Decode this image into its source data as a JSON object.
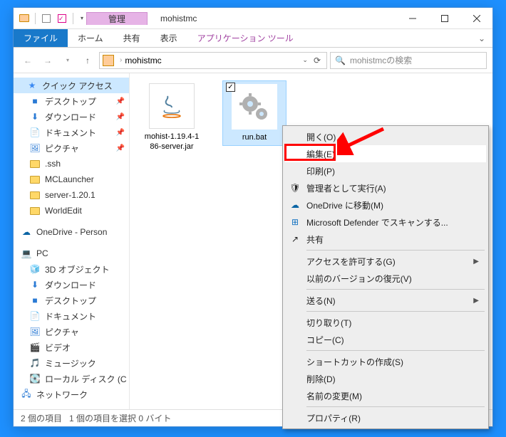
{
  "window": {
    "title": "mohistmc",
    "management_tab": "管理",
    "app_tools_tab": "アプリケーション ツール"
  },
  "ribbon": {
    "file": "ファイル",
    "home": "ホーム",
    "share": "共有",
    "view": "表示"
  },
  "address": {
    "folder": "mohistmc"
  },
  "search": {
    "placeholder": "mohistmcの検索"
  },
  "sidebar": {
    "quick_access": "クイック アクセス",
    "items_qa": [
      {
        "label": "デスクトップ",
        "pinned": true,
        "icon": "desktop"
      },
      {
        "label": "ダウンロード",
        "pinned": true,
        "icon": "download"
      },
      {
        "label": "ドキュメント",
        "pinned": true,
        "icon": "document"
      },
      {
        "label": "ピクチャ",
        "pinned": true,
        "icon": "picture"
      },
      {
        "label": ".ssh",
        "pinned": false,
        "icon": "folder"
      },
      {
        "label": "MCLauncher",
        "pinned": false,
        "icon": "folder"
      },
      {
        "label": "server-1.20.1",
        "pinned": false,
        "icon": "folder"
      },
      {
        "label": "WorldEdit",
        "pinned": false,
        "icon": "folder"
      }
    ],
    "onedrive": "OneDrive - Person",
    "pc": "PC",
    "items_pc": [
      {
        "label": "3D オブジェクト",
        "icon": "3d"
      },
      {
        "label": "ダウンロード",
        "icon": "download"
      },
      {
        "label": "デスクトップ",
        "icon": "desktop"
      },
      {
        "label": "ドキュメント",
        "icon": "document"
      },
      {
        "label": "ピクチャ",
        "icon": "picture"
      },
      {
        "label": "ビデオ",
        "icon": "video"
      },
      {
        "label": "ミュージック",
        "icon": "music"
      },
      {
        "label": "ローカル ディスク (C",
        "icon": "disk"
      }
    ],
    "network": "ネットワーク"
  },
  "files": [
    {
      "name": "mohist-1.19.4-186-server.jar",
      "type": "jar"
    },
    {
      "name": "run.bat",
      "type": "bat",
      "selected": true
    }
  ],
  "context_menu": {
    "open": "開く(O)",
    "edit": "編集(E)",
    "print": "印刷(P)",
    "run_admin": "管理者として実行(A)",
    "onedrive_move": "OneDrive に移動(M)",
    "defender": "Microsoft Defender でスキャンする...",
    "share": "共有",
    "access": "アクセスを許可する(G)",
    "restore": "以前のバージョンの復元(V)",
    "send_to": "送る(N)",
    "cut": "切り取り(T)",
    "copy": "コピー(C)",
    "shortcut": "ショートカットの作成(S)",
    "delete": "削除(D)",
    "rename": "名前の変更(M)",
    "properties": "プロパティ(R)"
  },
  "statusbar": {
    "count": "2 個の項目",
    "selection": "1 個の項目を選択 0 バイト"
  }
}
